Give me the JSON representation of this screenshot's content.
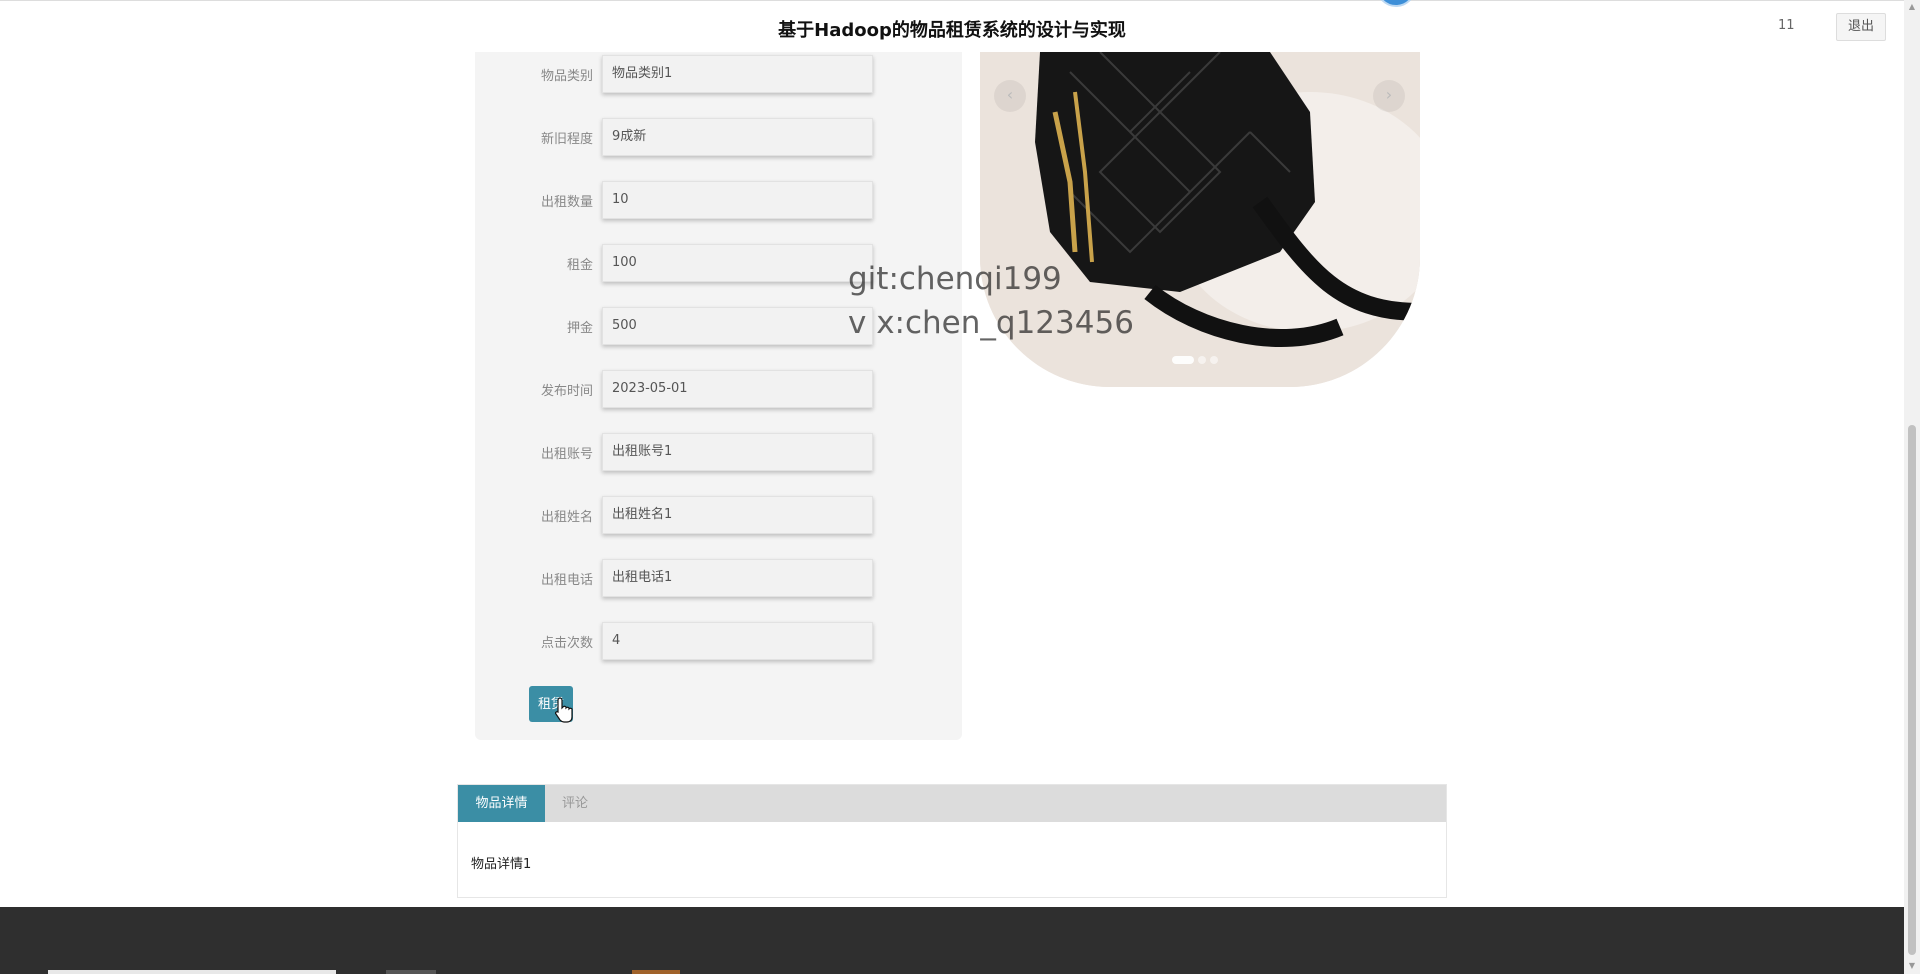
{
  "header": {
    "title": "基于Hadoop的物品租赁系统的设计与实现",
    "user": "11",
    "logout_label": "退出"
  },
  "form": {
    "fields": [
      {
        "label": "物品类别",
        "value": "物品类别1"
      },
      {
        "label": "新旧程度",
        "value": "9成新"
      },
      {
        "label": "出租数量",
        "value": "10"
      },
      {
        "label": "租金",
        "value": "100"
      },
      {
        "label": "押金",
        "value": "500"
      },
      {
        "label": "发布时间",
        "value": "2023-05-01"
      },
      {
        "label": "出租账号",
        "value": "出租账号1"
      },
      {
        "label": "出租姓名",
        "value": "出租姓名1"
      },
      {
        "label": "出租电话",
        "value": "出租电话1"
      },
      {
        "label": "点击次数",
        "value": "4"
      }
    ],
    "rent_button": "租赁"
  },
  "carousel": {
    "prev": "‹",
    "next": "›",
    "slide_count": 3,
    "active_slide": 1
  },
  "watermark": {
    "line1": "git:chenqi199",
    "line2": "v x:chen_q123456"
  },
  "tabs": {
    "items": [
      "物品详情",
      "评论"
    ],
    "active": "物品详情",
    "content": "物品详情1"
  },
  "colors": {
    "accent": "#3b8ea5",
    "footer": "#2f2f2f"
  }
}
